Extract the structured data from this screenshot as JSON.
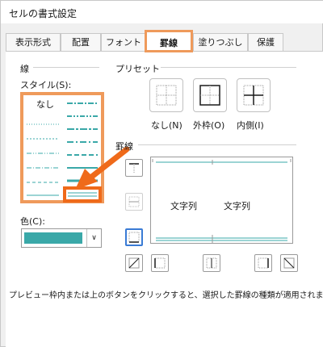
{
  "window": {
    "title": "セルの書式設定"
  },
  "tabs": [
    {
      "label": "表示形式"
    },
    {
      "label": "配置"
    },
    {
      "label": "フォント"
    },
    {
      "label": "罫線"
    },
    {
      "label": "塗りつぶし"
    },
    {
      "label": "保護"
    }
  ],
  "line_section": {
    "title": "線",
    "style_label": "スタイル(S):",
    "none_label": "なし",
    "color_label": "色(C):",
    "color_value": "#3aa8a8"
  },
  "preset_section": {
    "title": "プリセット",
    "buttons": [
      {
        "label": "なし(N)"
      },
      {
        "label": "外枠(O)"
      },
      {
        "label": "内側(I)"
      }
    ]
  },
  "border_section": {
    "title": "罫線",
    "preview_texts": [
      "文字列",
      "文字列"
    ]
  },
  "info_text": "プレビュー枠内または上のボタンをクリックすると、選択した罫線の種類が適用されます",
  "colors": {
    "accent_orange": "#ef9a5b",
    "arrow_orange": "#ef6a1a",
    "teal": "#3aa8a8",
    "focus_blue": "#3a7bd5"
  }
}
